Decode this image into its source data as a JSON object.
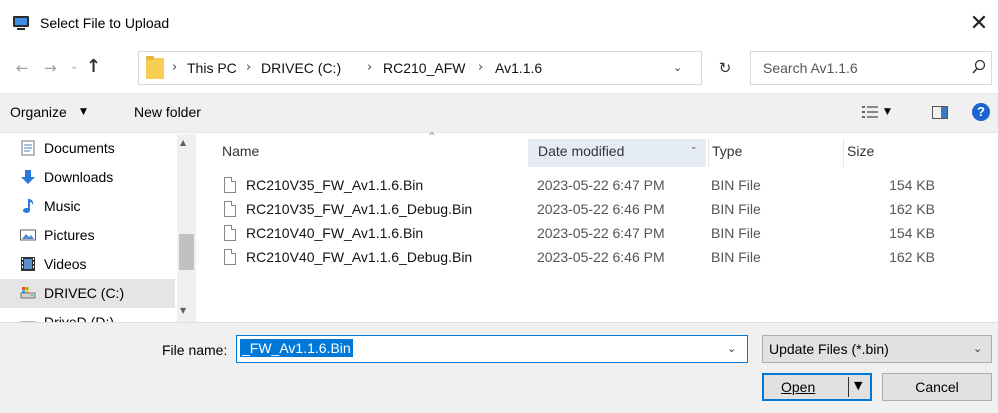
{
  "window": {
    "title": "Select File to Upload",
    "close_glyph": "✕",
    "icon": "upload-dialog-icon"
  },
  "nav": {
    "back_glyph": "←",
    "forward_glyph": "→",
    "recent_glyph": "⌄",
    "up_glyph": "↑",
    "breadcrumbs": [
      "This PC",
      "DRIVEC (C:)",
      "RC210_AFW",
      "Av1.1.6"
    ],
    "separator": "›",
    "dropdown_glyph": "⌄",
    "refresh_glyph": "↻",
    "search_placeholder": "Search Av1.1.6",
    "search_glyph": "⚲"
  },
  "toolbar": {
    "organize": "Organize",
    "organize_arrow": "▼",
    "new_folder": "New folder",
    "view_arrow": "▼",
    "help": "?"
  },
  "sidebar": {
    "items": [
      {
        "label": "Documents",
        "icon": "documents-icon"
      },
      {
        "label": "Downloads",
        "icon": "downloads-icon"
      },
      {
        "label": "Music",
        "icon": "music-icon"
      },
      {
        "label": "Pictures",
        "icon": "pictures-icon"
      },
      {
        "label": "Videos",
        "icon": "videos-icon"
      },
      {
        "label": "DRIVEC (C:)",
        "icon": "drive-icon",
        "selected": true
      },
      {
        "label": "DriveD (D:)",
        "icon": "drive-icon"
      }
    ],
    "scroll_up": "▲",
    "scroll_down": "▼"
  },
  "files": {
    "columns": {
      "name": "Name",
      "date": "Date modified",
      "type": "Type",
      "size": "Size"
    },
    "sort_caret": "^",
    "date_arrow": "⌄",
    "rows": [
      {
        "name": "RC210V35_FW_Av1.1.6.Bin",
        "date": "2023-05-22 6:47 PM",
        "type": "BIN File",
        "size": "154 KB"
      },
      {
        "name": "RC210V35_FW_Av1.1.6_Debug.Bin",
        "date": "2023-05-22 6:46 PM",
        "type": "BIN File",
        "size": "162 KB"
      },
      {
        "name": "RC210V40_FW_Av1.1.6.Bin",
        "date": "2023-05-22 6:47 PM",
        "type": "BIN File",
        "size": "154 KB"
      },
      {
        "name": "RC210V40_FW_Av1.1.6_Debug.Bin",
        "date": "2023-05-22 6:46 PM",
        "type": "BIN File",
        "size": "162 KB"
      }
    ]
  },
  "bottom": {
    "filename_label": "File name:",
    "filename_value": "_FW_Av1.1.6.Bin",
    "filename_dropdown": "⌄",
    "filetype_value": "Update Files (*.bin)",
    "filetype_arrow": "⌄",
    "open_label": "Open",
    "open_arrow": "▼",
    "cancel_label": "Cancel"
  },
  "colors": {
    "accent": "#0078d7",
    "selection": "#e5e5e5",
    "help_blue": "#1b64d1",
    "folder_yellow": "#f7cd53"
  }
}
